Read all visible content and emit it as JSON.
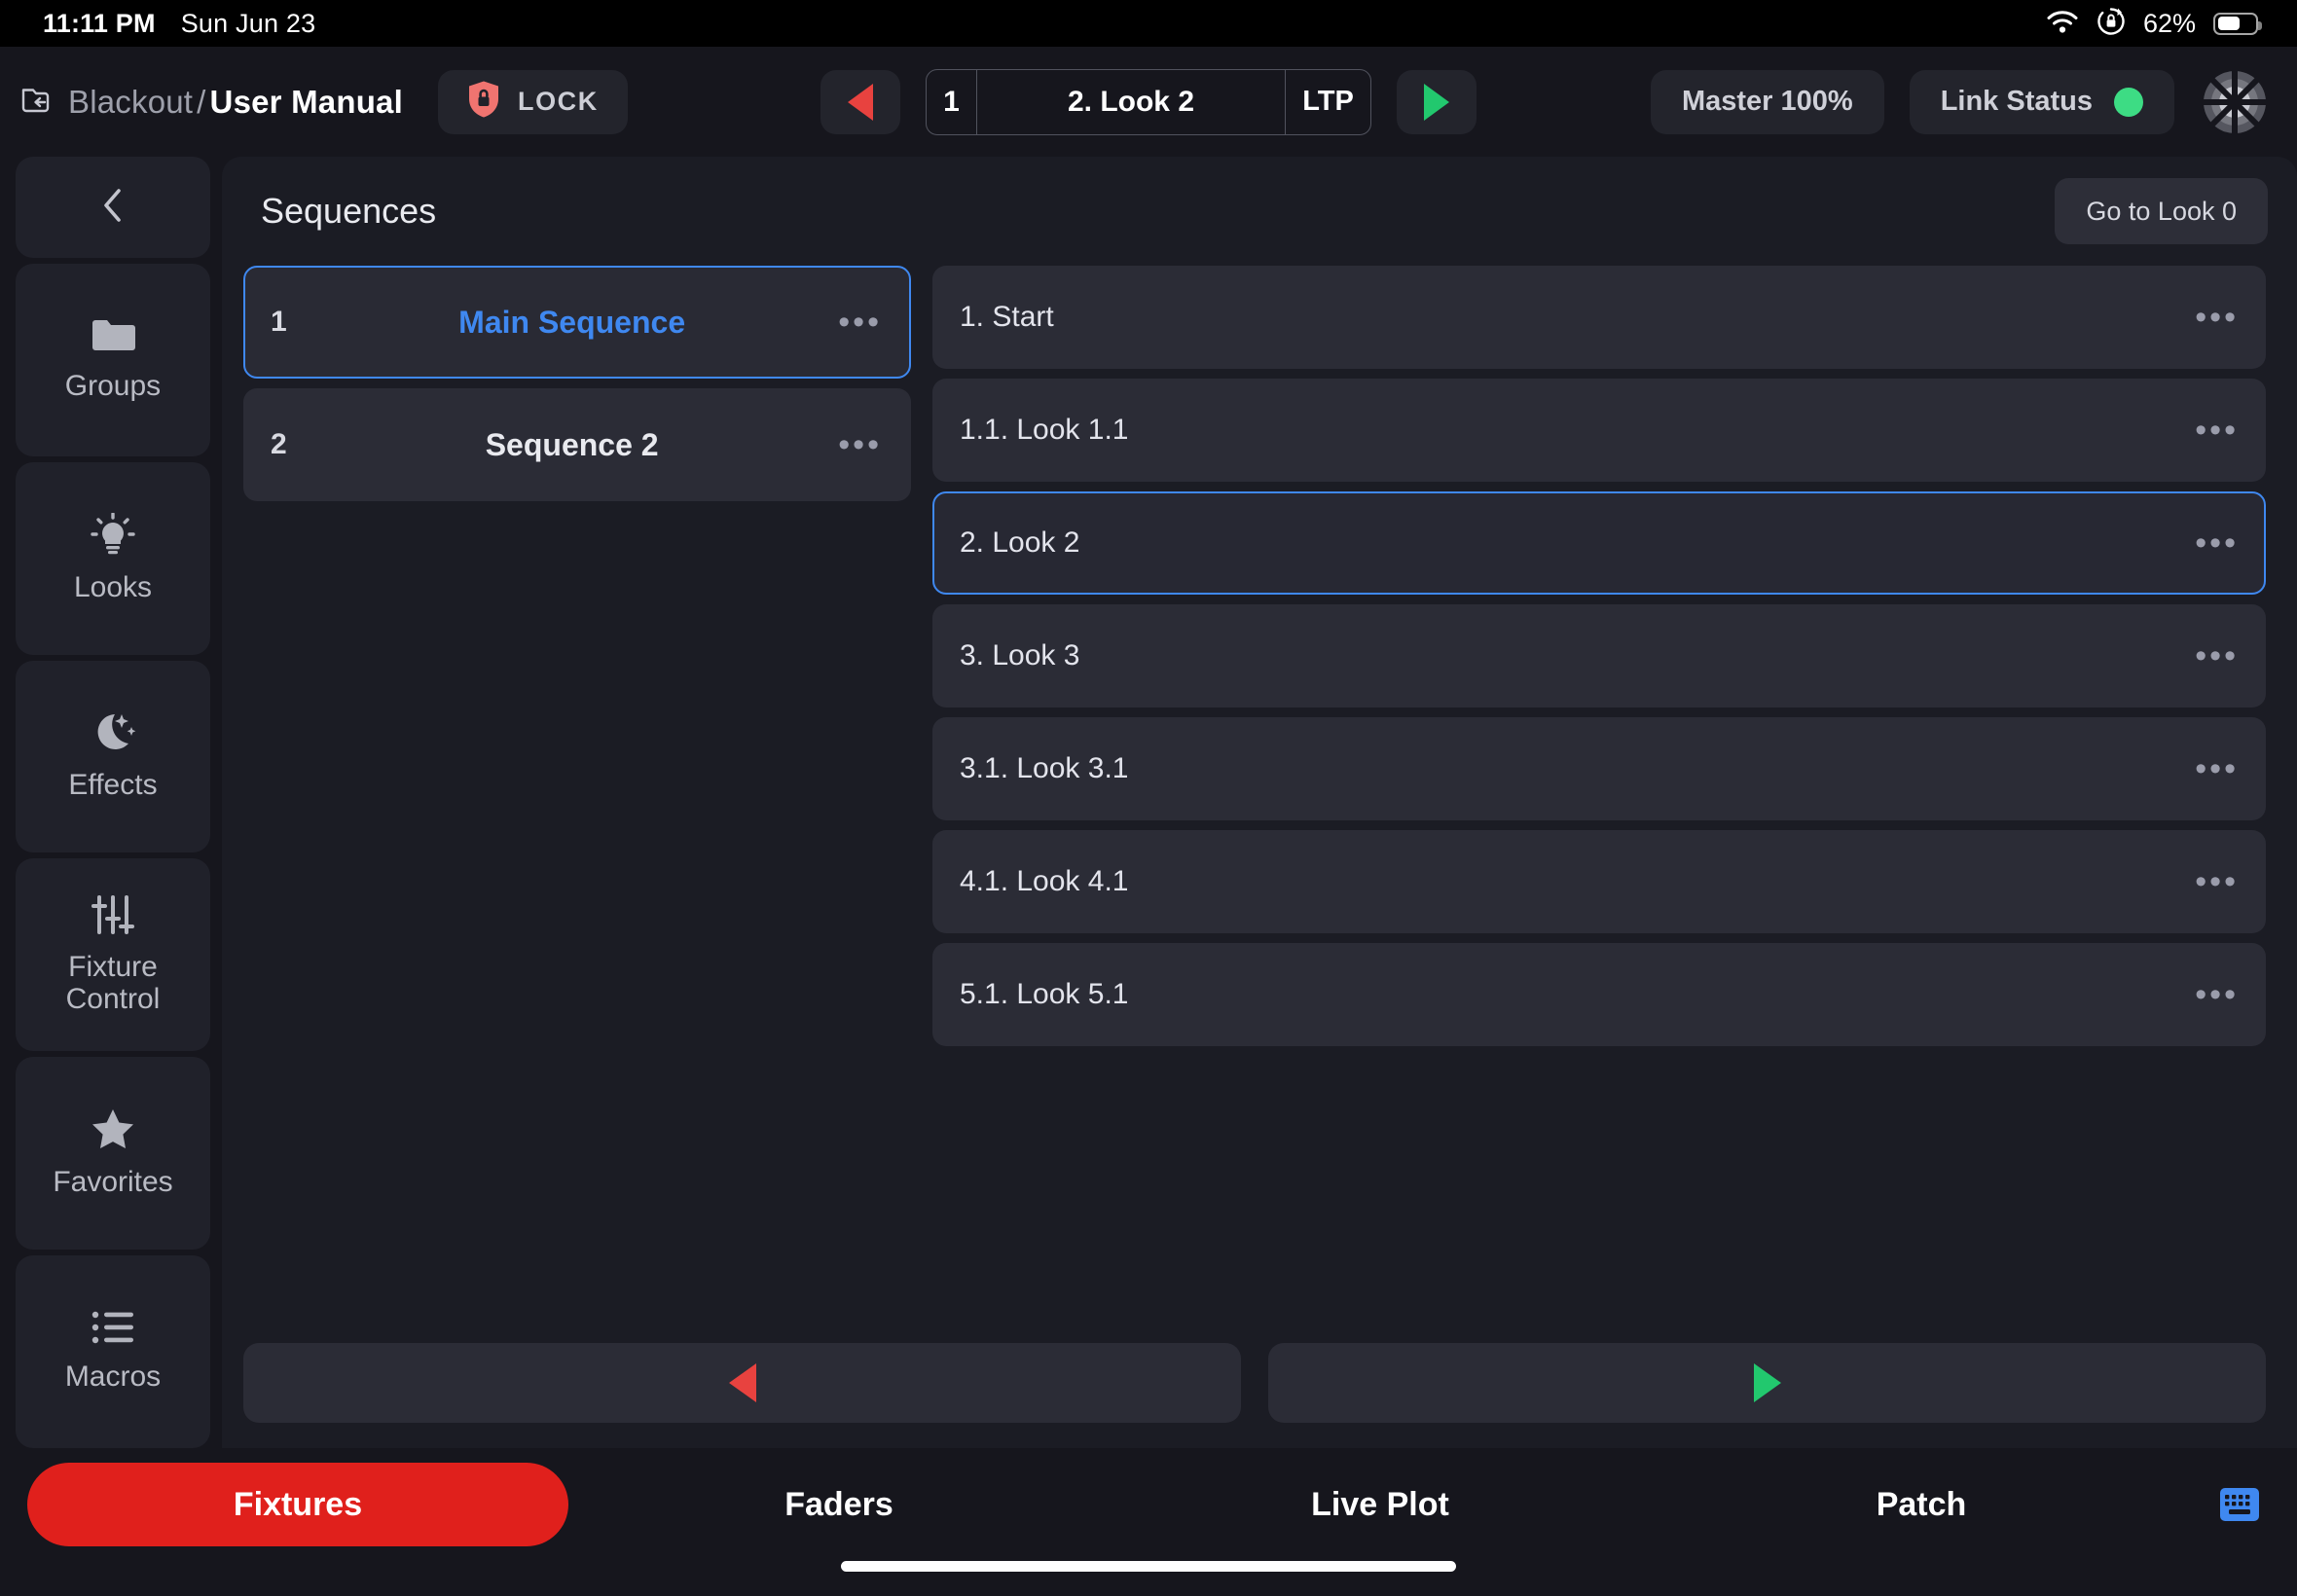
{
  "statusbar": {
    "time": "11:11 PM",
    "date": "Sun Jun 23",
    "battery_percent": "62%",
    "wifi_icon": "wifi-icon",
    "rotation_lock_icon": "rotation-lock-icon",
    "battery_icon": "battery-icon"
  },
  "header": {
    "breadcrumb_icon": "folder-back-icon",
    "breadcrumb_parent": "Blackout",
    "breadcrumb_separator": "/",
    "breadcrumb_current": "User Manual",
    "lock_button": {
      "label": "LOCK",
      "icon": "shield-lock-icon",
      "color": "#f07470"
    },
    "transport": {
      "prev_icon": "previous-triangle-icon",
      "next_icon": "next-triangle-icon",
      "cue_number": "1",
      "cue_name": "2. Look 2",
      "cue_mode": "LTP"
    },
    "master": {
      "label": "Master 100%"
    },
    "link_status": {
      "label": "Link Status",
      "dot_color": "#3ddc84"
    },
    "logo_icon": "radial-target-logo-icon"
  },
  "sidebar": {
    "collapse_icon": "chevron-left-icon",
    "items": [
      {
        "label": "Groups",
        "icon": "folder-icon"
      },
      {
        "label": "Looks",
        "icon": "lightbulb-icon"
      },
      {
        "label": "Effects",
        "icon": "moon-stars-icon"
      },
      {
        "label": "Fixture\nControl",
        "label_line1": "Fixture",
        "label_line2": "Control",
        "icon": "sliders-icon"
      },
      {
        "label": "Favorites",
        "icon": "star-icon"
      },
      {
        "label": "Macros",
        "icon": "list-icon"
      }
    ]
  },
  "panel": {
    "title": "Sequences",
    "goto_button": "Go to Look 0",
    "sequences": [
      {
        "index": "1",
        "name": "Main Sequence",
        "selected": true,
        "menu_icon": "ellipsis-icon"
      },
      {
        "index": "2",
        "name": "Sequence 2",
        "selected": false,
        "menu_icon": "ellipsis-icon"
      }
    ],
    "looks": [
      {
        "name": "1. Start",
        "selected": false,
        "menu_icon": "ellipsis-icon"
      },
      {
        "name": "1.1. Look 1.1",
        "selected": false,
        "menu_icon": "ellipsis-icon"
      },
      {
        "name": "2. Look 2",
        "selected": true,
        "menu_icon": "ellipsis-icon"
      },
      {
        "name": "3. Look 3",
        "selected": false,
        "menu_icon": "ellipsis-icon"
      },
      {
        "name": "3.1. Look 3.1",
        "selected": false,
        "menu_icon": "ellipsis-icon"
      },
      {
        "name": "4.1. Look 4.1",
        "selected": false,
        "menu_icon": "ellipsis-icon"
      },
      {
        "name": "5.1. Look 5.1",
        "selected": false,
        "menu_icon": "ellipsis-icon"
      }
    ],
    "transport": {
      "back_icon": "previous-triangle-icon",
      "forward_icon": "next-triangle-icon"
    }
  },
  "tabbar": {
    "tabs": [
      {
        "label": "Fixtures",
        "active": true
      },
      {
        "label": "Faders",
        "active": false
      },
      {
        "label": "Live Plot",
        "active": false
      },
      {
        "label": "Patch",
        "active": false
      }
    ],
    "keyboard_icon": "keyboard-icon",
    "active_color": "#e0201c"
  },
  "colors": {
    "background": "#16161d",
    "panel": "#1b1c24",
    "card": "#2b2c36",
    "accent_blue": "#3f88f0",
    "accent_red": "#e0201c",
    "accent_green": "#3ddc84"
  }
}
